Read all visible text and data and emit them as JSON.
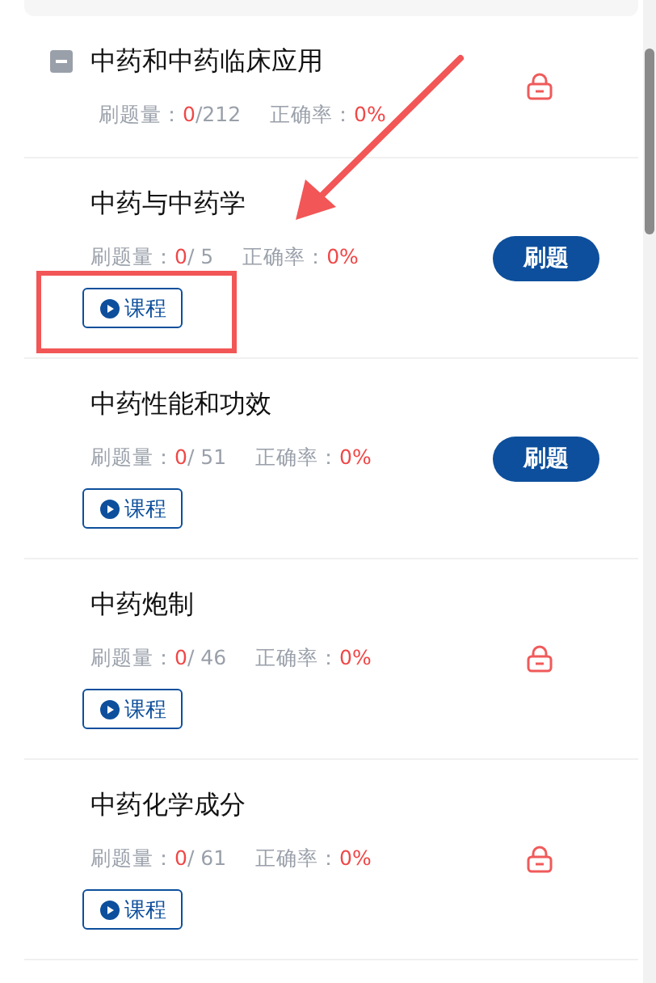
{
  "chapter": {
    "title": "中药和中药临床应用",
    "expanded": true,
    "count_label": "刷题量：",
    "count_done": "0",
    "count_total": "/212",
    "accuracy_label": "正确率：",
    "accuracy": "0%",
    "action": {
      "kind": "locked"
    }
  },
  "sections": [
    {
      "title": "中药与中药学",
      "count_label": "刷题量：",
      "count_done": "0",
      "count_total": "/ 5",
      "accuracy_label": "正确率：",
      "accuracy": "0%",
      "action": {
        "kind": "practice",
        "label": "刷题"
      },
      "course": "课程"
    },
    {
      "title": "中药性能和功效",
      "count_label": "刷题量：",
      "count_done": "0",
      "count_total": "/ 51",
      "accuracy_label": "正确率：",
      "accuracy": "0%",
      "action": {
        "kind": "practice",
        "label": "刷题"
      },
      "course": "课程"
    },
    {
      "title": "中药炮制",
      "count_label": "刷题量：",
      "count_done": "0",
      "count_total": "/ 46",
      "accuracy_label": "正确率：",
      "accuracy": "0%",
      "action": {
        "kind": "locked"
      },
      "course": "课程"
    },
    {
      "title": "中药化学成分",
      "count_label": "刷题量：",
      "count_done": "0",
      "count_total": "/ 61",
      "accuracy_label": "正确率：",
      "accuracy": "0%",
      "action": {
        "kind": "locked"
      },
      "course": "课程"
    }
  ]
}
